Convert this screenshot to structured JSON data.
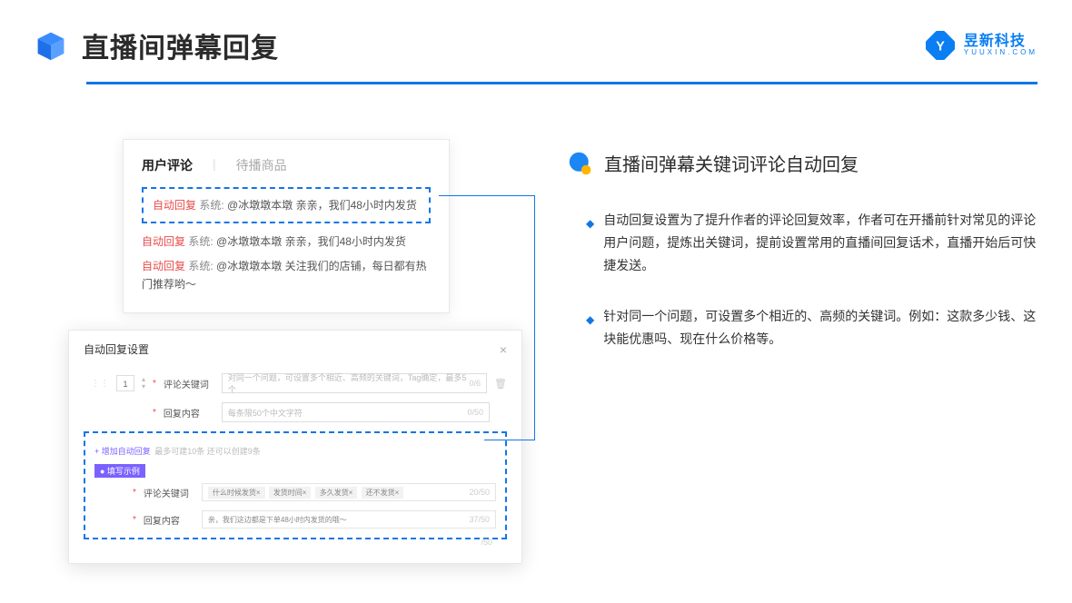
{
  "header": {
    "title": "直播间弹幕回复",
    "brand_name": "昱新科技",
    "brand_url": "YUUXIN.COM"
  },
  "comments_card": {
    "tab_active": "用户评论",
    "tab_inactive": "待播商品",
    "auto_tag": "自动回复",
    "sys_label": "系统:",
    "line1": "@冰墩墩本墩 亲亲，我们48小时内发货",
    "line2": "@冰墩墩本墩 亲亲，我们48小时内发货",
    "line3": "@冰墩墩本墩 关注我们的店铺，每日都有热门推荐哟～"
  },
  "settings_card": {
    "title": "自动回复设置",
    "num": "1",
    "label_keyword": "评论关键词",
    "placeholder_keyword": "对同一个问题，可设置多个相近、高频的关键词，Tag确定，最多5个",
    "count_keyword": "0/6",
    "label_reply": "回复内容",
    "placeholder_reply": "每条限50个中文字符",
    "count_reply": "0/50",
    "add_text": "+ 增加自动回复",
    "hint": "最多可建10条 还可以创建9条",
    "example_badge": "● 填写示例",
    "ex_label_kw": "评论关键词",
    "ex_tags": [
      "什么时候发货×",
      "发货时间×",
      "多久发货×",
      "还不发货×"
    ],
    "ex_kw_count": "20/50",
    "ex_label_reply": "回复内容",
    "ex_reply_text": "亲，我们这边都是下单48小时内发货的哦～",
    "ex_reply_count": "37/50",
    "trailing_count": "/50"
  },
  "right": {
    "sub_title": "直播间弹幕关键词评论自动回复",
    "bullet1": "自动回复设置为了提升作者的评论回复效率，作者可在开播前针对常见的评论用户问题，提炼出关键词，提前设置常用的直播间回复话术，直播开始后可快捷发送。",
    "bullet2": "针对同一个问题，可设置多个相近的、高频的关键词。例如：这款多少钱、这块能优惠吗、现在什么价格等。"
  }
}
